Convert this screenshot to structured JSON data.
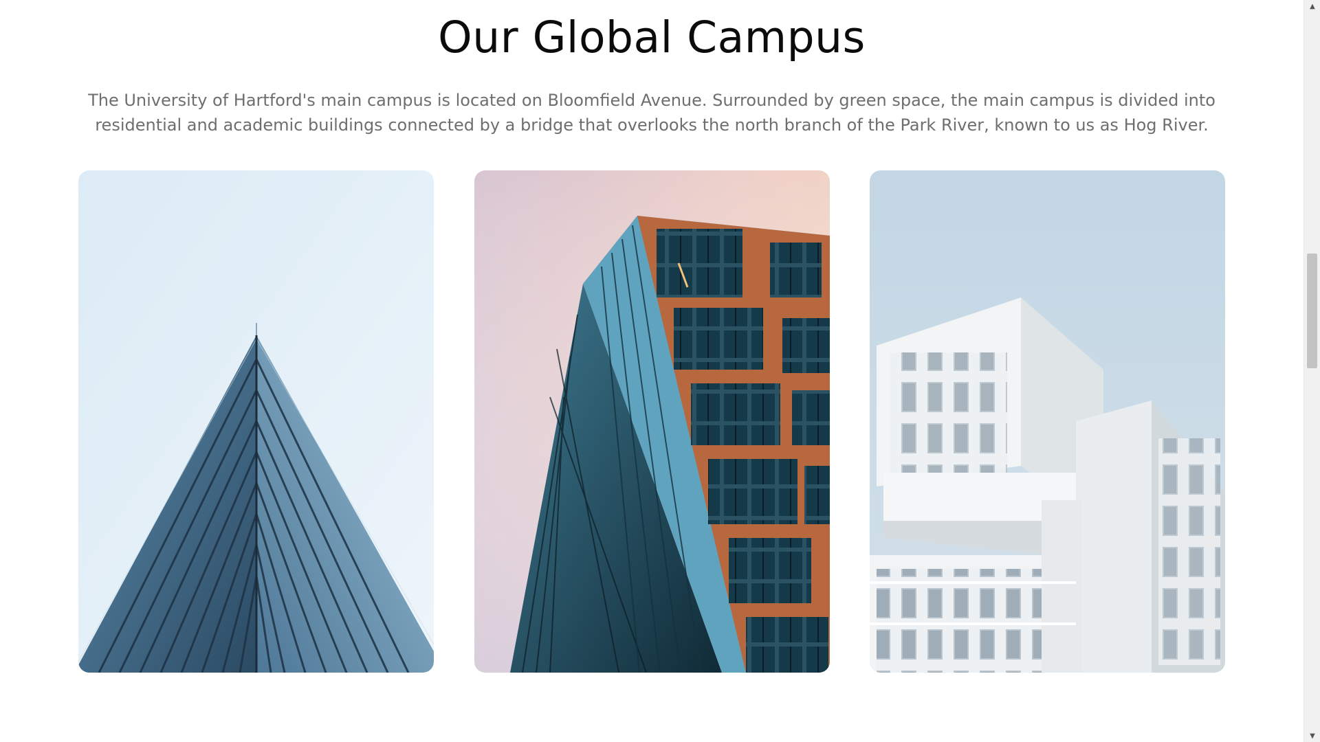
{
  "section": {
    "title": "Our Global Campus",
    "description": "The University of Hartford's main campus is located on Bloomfield Avenue. Surrounded by green space, the main campus is divided into residential and academic buildings connected by a bridge that overlooks the north branch of the Park River, known to us as Hog River."
  },
  "gallery": {
    "images": [
      {
        "icon": "glass-pyramid-building-photo"
      },
      {
        "icon": "glass-copper-tower-photo"
      },
      {
        "icon": "white-modular-building-photo"
      }
    ]
  },
  "scrollbar": {
    "up_icon": "scroll-up-arrow",
    "down_icon": "scroll-down-arrow"
  },
  "colors": {
    "title": "#0b0b0b",
    "text": "#6e6e6e",
    "copper": "#b8683f"
  }
}
